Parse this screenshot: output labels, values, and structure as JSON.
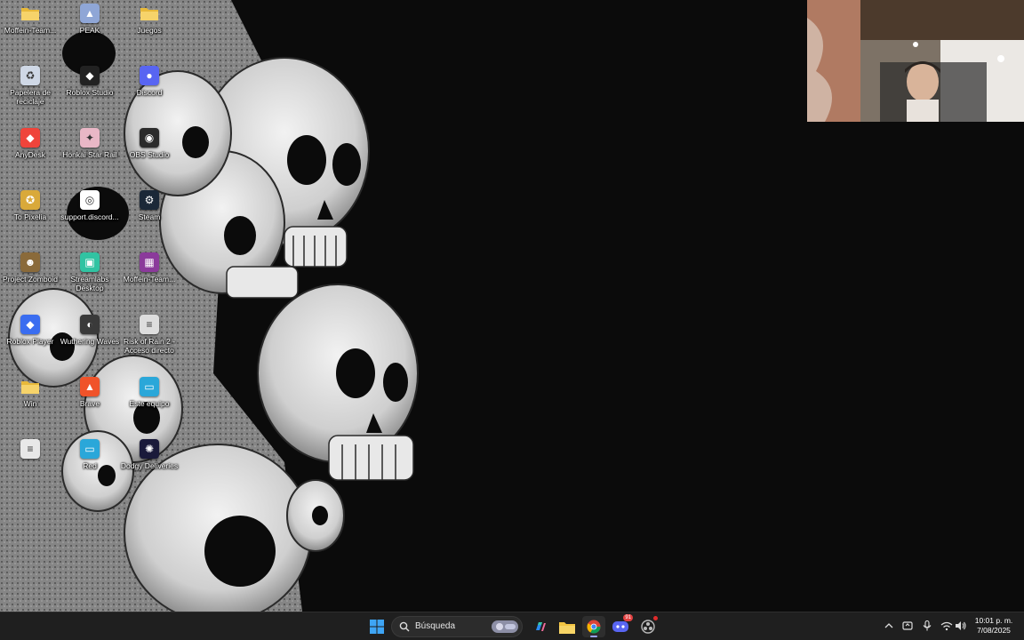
{
  "desktop": {
    "icons": [
      {
        "label": "Moffein-Team...",
        "icon": "folder-icon",
        "color": "#e8b93a"
      },
      {
        "label": "PEAK",
        "icon": "peak-game-icon",
        "color": "#8fa6d6"
      },
      {
        "label": "Juegos",
        "icon": "folder-icon",
        "color": "#e8b93a"
      },
      {
        "label": "Papelera de reciclaje",
        "icon": "recycle-bin-icon",
        "color": "#cfd8e6"
      },
      {
        "label": "Roblox Studio",
        "icon": "roblox-studio-icon",
        "color": "#222222"
      },
      {
        "label": "Discord",
        "icon": "discord-icon",
        "color": "#5865f2"
      },
      {
        "label": "AnyDesk",
        "icon": "anydesk-icon",
        "color": "#ef443b"
      },
      {
        "label": "Honkai Star Rail",
        "icon": "honkai-star-rail-icon",
        "color": "#e9b7c6"
      },
      {
        "label": "OBS Studio",
        "icon": "obs-studio-icon",
        "color": "#2b2b2b"
      },
      {
        "label": "To Pixelia",
        "icon": "to-pixelia-icon",
        "color": "#d9a93a"
      },
      {
        "label": "support.discord...",
        "icon": "chrome-shortcut-icon",
        "color": "#ffffff"
      },
      {
        "label": "Steam",
        "icon": "steam-icon",
        "color": "#1b2838"
      },
      {
        "label": "Project Zomboid",
        "icon": "project-zomboid-icon",
        "color": "#8a6a3a"
      },
      {
        "label": "Streamlabs Desktop",
        "icon": "streamlabs-icon",
        "color": "#31c3a2"
      },
      {
        "label": "Moffein-Team...",
        "icon": "winrar-icon",
        "color": "#8b3a9b"
      },
      {
        "label": "Roblox Player",
        "icon": "roblox-player-icon",
        "color": "#3a6df0"
      },
      {
        "label": "Wuthering Waves",
        "icon": "wuthering-waves-icon",
        "color": "#3a3a3a"
      },
      {
        "label": "Risk of Rain 2 - Acceso directo",
        "icon": "risk-of-rain-icon",
        "color": "#dddddd"
      },
      {
        "label": "Win",
        "icon": "folder-icon",
        "color": "#e8b93a"
      },
      {
        "label": "Brave",
        "icon": "brave-icon",
        "color": "#f0532a"
      },
      {
        "label": "Este equipo",
        "icon": "this-pc-icon",
        "color": "#2aa7d9"
      },
      {
        "label": "",
        "icon": "text-file-icon",
        "color": "#e8e8e8"
      },
      {
        "label": "Red",
        "icon": "network-icon",
        "color": "#2aa7d9"
      },
      {
        "label": "Dodgy Deliveries",
        "icon": "dodgy-deliveries-icon",
        "color": "#1a1a3a"
      }
    ]
  },
  "taskbar": {
    "search_placeholder": "Búsqueda",
    "clock_time": "10:01 p. m.",
    "clock_date": "7/08/2025",
    "discord_badge": "91",
    "accent": "#0078d4"
  }
}
